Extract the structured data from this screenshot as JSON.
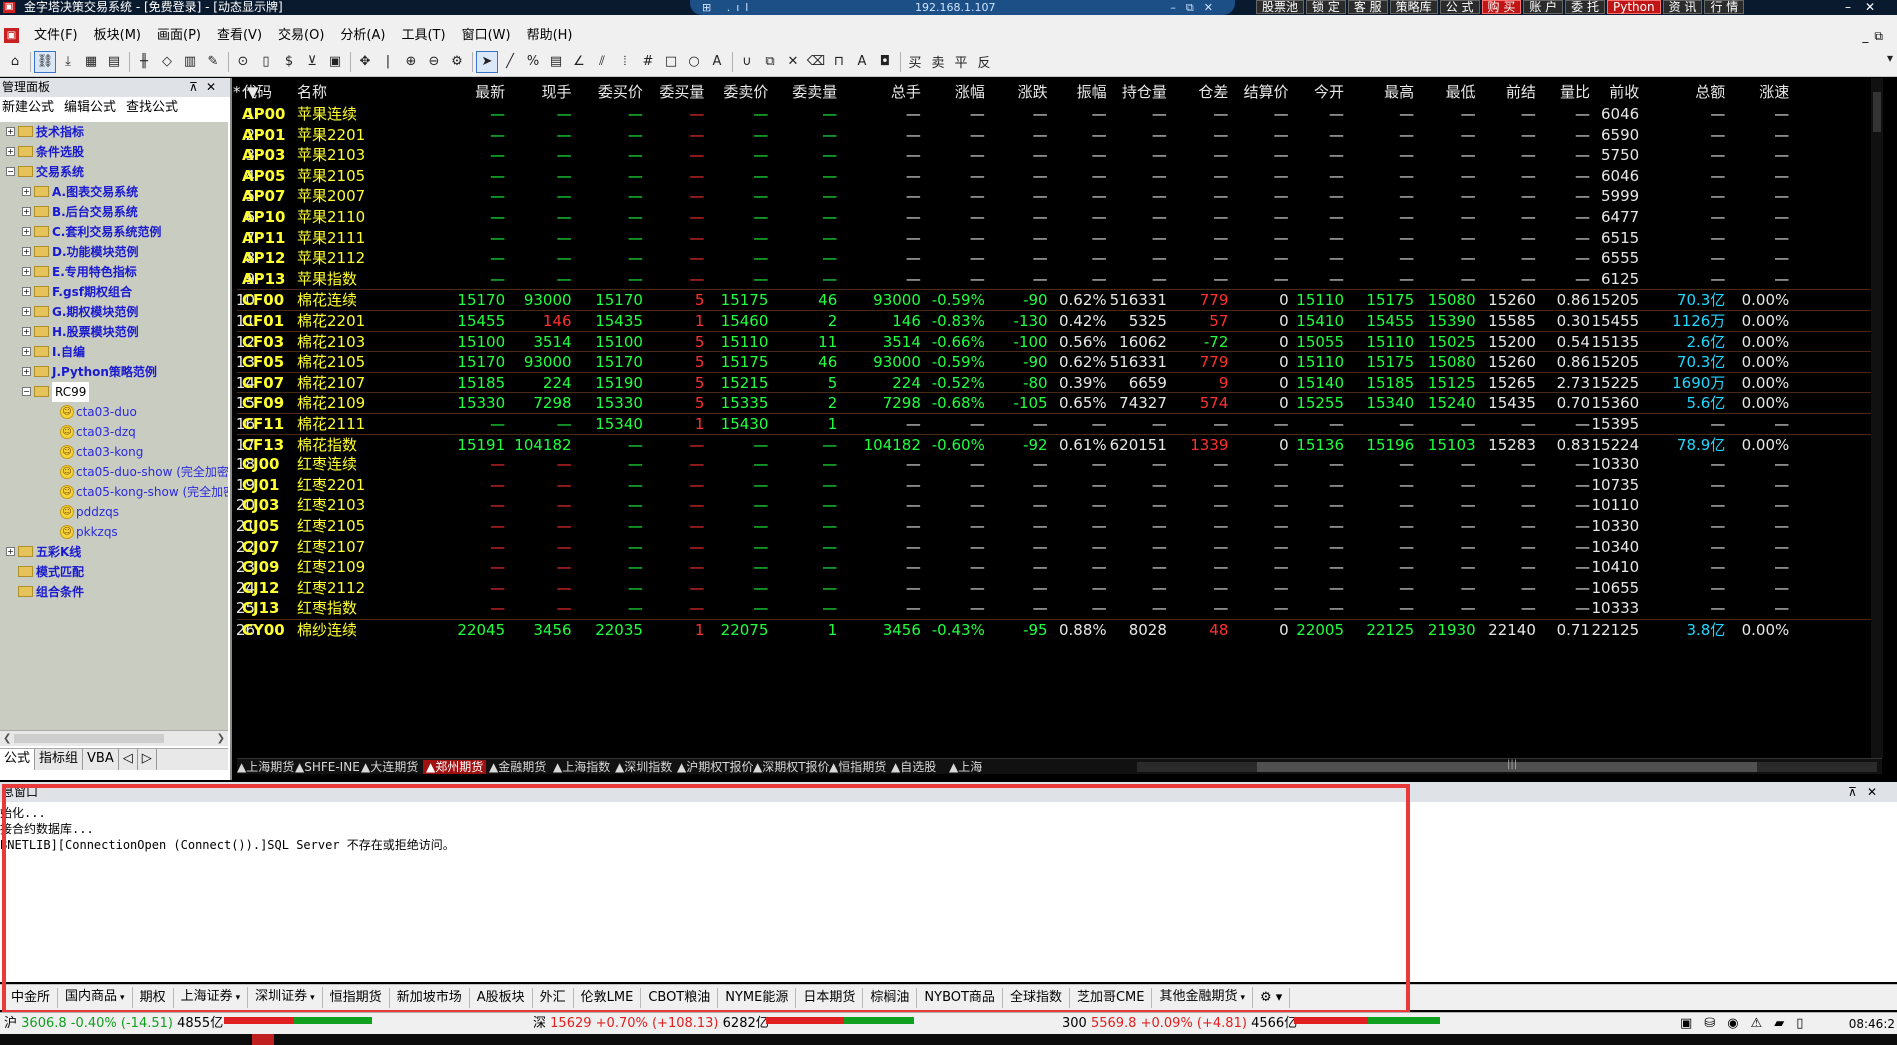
{
  "window": {
    "title": "金字塔决策交易系统 - [免费登录] - [动态显示牌]",
    "server_ip": "192.168.1.107"
  },
  "top_buttons": [
    "股票池",
    "锁 定",
    "客 服",
    "策略库",
    "公 式",
    "购 买",
    "账 户",
    "委 托",
    "Python",
    "资 讯",
    "行 情"
  ],
  "top_buttons_red": [
    "购 买",
    "Python"
  ],
  "menu": [
    "文件(F)",
    "板块(M)",
    "画面(P)",
    "查看(V)",
    "交易(O)",
    "分析(A)",
    "工具(T)",
    "窗口(W)",
    "帮助(H)"
  ],
  "left_panel": {
    "title": "管理面板",
    "actions": [
      "新建公式",
      "编辑公式",
      "查找公式"
    ],
    "tree": [
      {
        "label": "技术指标",
        "level": 0,
        "kind": "folder",
        "exp": "+"
      },
      {
        "label": "条件选股",
        "level": 0,
        "kind": "folder",
        "exp": "+"
      },
      {
        "label": "交易系统",
        "level": 0,
        "kind": "folder",
        "exp": "-"
      },
      {
        "label": "A.图表交易系统",
        "level": 1,
        "kind": "folder",
        "exp": "+"
      },
      {
        "label": "B.后台交易系统",
        "level": 1,
        "kind": "folder",
        "exp": "+"
      },
      {
        "label": "C.套利交易系统范例",
        "level": 1,
        "kind": "folder",
        "exp": "+"
      },
      {
        "label": "D.功能模块范例",
        "level": 1,
        "kind": "folder",
        "exp": "+"
      },
      {
        "label": "E.专用特色指标",
        "level": 1,
        "kind": "folder",
        "exp": "+"
      },
      {
        "label": "F.gsf期权组合",
        "level": 1,
        "kind": "folder",
        "exp": "+"
      },
      {
        "label": "G.期权模块范例",
        "level": 1,
        "kind": "folder",
        "exp": "+"
      },
      {
        "label": "H.股票模块范例",
        "level": 1,
        "kind": "folder",
        "exp": "+"
      },
      {
        "label": "I.自编",
        "level": 1,
        "kind": "folder",
        "exp": "+"
      },
      {
        "label": "J.Python策略范例",
        "level": 1,
        "kind": "folder",
        "exp": "+"
      },
      {
        "label": "RC99",
        "level": 1,
        "kind": "folder-sel",
        "exp": "-"
      },
      {
        "label": "cta03-duo",
        "level": 2,
        "kind": "leaf"
      },
      {
        "label": "cta03-dzq",
        "level": 2,
        "kind": "leaf"
      },
      {
        "label": "cta03-kong",
        "level": 2,
        "kind": "leaf"
      },
      {
        "label": "cta05-duo-show (完全加密",
        "level": 2,
        "kind": "leaf"
      },
      {
        "label": "cta05-kong-show (完全加密",
        "level": 2,
        "kind": "leaf"
      },
      {
        "label": "pddzqs",
        "level": 2,
        "kind": "leaf"
      },
      {
        "label": "pkkzqs",
        "level": 2,
        "kind": "leaf"
      },
      {
        "label": "五彩K线",
        "level": 0,
        "kind": "folder",
        "exp": "+"
      },
      {
        "label": "模式匹配",
        "level": 0,
        "kind": "folder",
        "exp": ""
      },
      {
        "label": "组合条件",
        "level": 0,
        "kind": "folder",
        "exp": ""
      }
    ],
    "tabs": [
      "公式",
      "指标组",
      "VBA",
      "◁",
      "▷"
    ]
  },
  "grid": {
    "headers": [
      "*",
      "代码",
      "名称",
      "最新",
      "现手",
      "委买价",
      "委买量",
      "委卖价",
      "委卖量",
      "总手",
      "涨幅",
      "涨跌",
      "振幅",
      "持仓量",
      "仓差",
      "结算价",
      "今开",
      "最高",
      "最低",
      "前结",
      "量比",
      "前收",
      "总额",
      "涨速"
    ],
    "rows": [
      [
        "1",
        "AP00",
        "苹果连续",
        "—",
        "—",
        "—",
        "—",
        "—",
        "—",
        "—",
        "—",
        "—",
        "—",
        "—",
        "—",
        "—",
        "—",
        "—",
        "—",
        "—",
        "—",
        "6046",
        "—",
        "—"
      ],
      [
        "2",
        "AP01",
        "苹果2201",
        "—",
        "—",
        "—",
        "—",
        "—",
        "—",
        "—",
        "—",
        "—",
        "—",
        "—",
        "—",
        "—",
        "—",
        "—",
        "—",
        "—",
        "—",
        "6590",
        "—",
        "—"
      ],
      [
        "3",
        "AP03",
        "苹果2103",
        "—",
        "—",
        "—",
        "—",
        "—",
        "—",
        "—",
        "—",
        "—",
        "—",
        "—",
        "—",
        "—",
        "—",
        "—",
        "—",
        "—",
        "—",
        "5750",
        "—",
        "—"
      ],
      [
        "4",
        "AP05",
        "苹果2105",
        "—",
        "—",
        "—",
        "—",
        "—",
        "—",
        "—",
        "—",
        "—",
        "—",
        "—",
        "—",
        "—",
        "—",
        "—",
        "—",
        "—",
        "—",
        "6046",
        "—",
        "—"
      ],
      [
        "5",
        "AP07",
        "苹果2007",
        "—",
        "—",
        "—",
        "—",
        "—",
        "—",
        "—",
        "—",
        "—",
        "—",
        "—",
        "—",
        "—",
        "—",
        "—",
        "—",
        "—",
        "—",
        "5999",
        "—",
        "—"
      ],
      [
        "6",
        "AP10",
        "苹果2110",
        "—",
        "—",
        "—",
        "—",
        "—",
        "—",
        "—",
        "—",
        "—",
        "—",
        "—",
        "—",
        "—",
        "—",
        "—",
        "—",
        "—",
        "—",
        "6477",
        "—",
        "—"
      ],
      [
        "7",
        "AP11",
        "苹果2111",
        "—",
        "—",
        "—",
        "—",
        "—",
        "—",
        "—",
        "—",
        "—",
        "—",
        "—",
        "—",
        "—",
        "—",
        "—",
        "—",
        "—",
        "—",
        "6515",
        "—",
        "—"
      ],
      [
        "8",
        "AP12",
        "苹果2112",
        "—",
        "—",
        "—",
        "—",
        "—",
        "—",
        "—",
        "—",
        "—",
        "—",
        "—",
        "—",
        "—",
        "—",
        "—",
        "—",
        "—",
        "—",
        "6555",
        "—",
        "—"
      ],
      [
        "9",
        "AP13",
        "苹果指数",
        "—",
        "—",
        "—",
        "—",
        "—",
        "—",
        "—",
        "—",
        "—",
        "—",
        "—",
        "—",
        "—",
        "—",
        "—",
        "—",
        "—",
        "—",
        "6125",
        "—",
        "—"
      ],
      [
        "10",
        "CF00",
        "棉花连续",
        "15170",
        "93000",
        "15170",
        "5",
        "15175",
        "46",
        "93000",
        "-0.59%",
        "-90",
        "0.62%",
        "516331",
        "779",
        "0",
        "15110",
        "15175",
        "15080",
        "15260",
        "0.86",
        "15205",
        "70.3亿",
        "0.00%"
      ],
      [
        "11",
        "CF01",
        "棉花2201",
        "15455",
        "146",
        "15435",
        "1",
        "15460",
        "2",
        "146",
        "-0.83%",
        "-130",
        "0.42%",
        "5325",
        "57",
        "0",
        "15410",
        "15455",
        "15390",
        "15585",
        "0.30",
        "15455",
        "1126万",
        "0.00%"
      ],
      [
        "12",
        "CF03",
        "棉花2103",
        "15100",
        "3514",
        "15100",
        "5",
        "15110",
        "11",
        "3514",
        "-0.66%",
        "-100",
        "0.56%",
        "16062",
        "-72",
        "0",
        "15055",
        "15110",
        "15025",
        "15200",
        "0.54",
        "15135",
        "2.6亿",
        "0.00%"
      ],
      [
        "13",
        "CF05",
        "棉花2105",
        "15170",
        "93000",
        "15170",
        "5",
        "15175",
        "46",
        "93000",
        "-0.59%",
        "-90",
        "0.62%",
        "516331",
        "779",
        "0",
        "15110",
        "15175",
        "15080",
        "15260",
        "0.86",
        "15205",
        "70.3亿",
        "0.00%"
      ],
      [
        "14",
        "CF07",
        "棉花2107",
        "15185",
        "224",
        "15190",
        "5",
        "15215",
        "5",
        "224",
        "-0.52%",
        "-80",
        "0.39%",
        "6659",
        "9",
        "0",
        "15140",
        "15185",
        "15125",
        "15265",
        "2.73",
        "15225",
        "1690万",
        "0.00%"
      ],
      [
        "15",
        "CF09",
        "棉花2109",
        "15330",
        "7298",
        "15330",
        "5",
        "15335",
        "2",
        "7298",
        "-0.68%",
        "-105",
        "0.65%",
        "74327",
        "574",
        "0",
        "15255",
        "15340",
        "15240",
        "15435",
        "0.70",
        "15360",
        "5.6亿",
        "0.00%"
      ],
      [
        "16",
        "CF11",
        "棉花2111",
        "—",
        "—",
        "15340",
        "1",
        "15430",
        "1",
        "—",
        "—",
        "—",
        "—",
        "—",
        "—",
        "—",
        "—",
        "—",
        "—",
        "—",
        "—",
        "15395",
        "—",
        "—"
      ],
      [
        "17",
        "CF13",
        "棉花指数",
        "15191",
        "104182",
        "—",
        "—",
        "—",
        "—",
        "104182",
        "-0.60%",
        "-92",
        "0.61%",
        "620151",
        "1339",
        "0",
        "15136",
        "15196",
        "15103",
        "15283",
        "0.83",
        "15224",
        "78.9亿",
        "0.00%"
      ],
      [
        "18",
        "CJ00",
        "红枣连续",
        "—",
        "—",
        "—",
        "—",
        "—",
        "—",
        "—",
        "—",
        "—",
        "—",
        "—",
        "—",
        "—",
        "—",
        "—",
        "—",
        "—",
        "—",
        "10330",
        "—",
        "—"
      ],
      [
        "19",
        "CJ01",
        "红枣2201",
        "—",
        "—",
        "—",
        "—",
        "—",
        "—",
        "—",
        "—",
        "—",
        "—",
        "—",
        "—",
        "—",
        "—",
        "—",
        "—",
        "—",
        "—",
        "10735",
        "—",
        "—"
      ],
      [
        "20",
        "CJ03",
        "红枣2103",
        "—",
        "—",
        "—",
        "—",
        "—",
        "—",
        "—",
        "—",
        "—",
        "—",
        "—",
        "—",
        "—",
        "—",
        "—",
        "—",
        "—",
        "—",
        "10110",
        "—",
        "—"
      ],
      [
        "21",
        "CJ05",
        "红枣2105",
        "—",
        "—",
        "—",
        "—",
        "—",
        "—",
        "—",
        "—",
        "—",
        "—",
        "—",
        "—",
        "—",
        "—",
        "—",
        "—",
        "—",
        "—",
        "10330",
        "—",
        "—"
      ],
      [
        "22",
        "CJ07",
        "红枣2107",
        "—",
        "—",
        "—",
        "—",
        "—",
        "—",
        "—",
        "—",
        "—",
        "—",
        "—",
        "—",
        "—",
        "—",
        "—",
        "—",
        "—",
        "—",
        "10340",
        "—",
        "—"
      ],
      [
        "23",
        "CJ09",
        "红枣2109",
        "—",
        "—",
        "—",
        "—",
        "—",
        "—",
        "—",
        "—",
        "—",
        "—",
        "—",
        "—",
        "—",
        "—",
        "—",
        "—",
        "—",
        "—",
        "10410",
        "—",
        "—"
      ],
      [
        "24",
        "CJ12",
        "红枣2112",
        "—",
        "—",
        "—",
        "—",
        "—",
        "—",
        "—",
        "—",
        "—",
        "—",
        "—",
        "—",
        "—",
        "—",
        "—",
        "—",
        "—",
        "—",
        "10655",
        "—",
        "—"
      ],
      [
        "25",
        "CJ13",
        "红枣指数",
        "—",
        "—",
        "—",
        "—",
        "—",
        "—",
        "—",
        "—",
        "—",
        "—",
        "—",
        "—",
        "—",
        "—",
        "—",
        "—",
        "—",
        "—",
        "10333",
        "—",
        "—"
      ],
      [
        "26",
        "CY00",
        "棉纱连续",
        "22045",
        "3456",
        "22035",
        "1",
        "22075",
        "1",
        "3456",
        "-0.43%",
        "-95",
        "0.88%",
        "8028",
        "48",
        "0",
        "22005",
        "22125",
        "21930",
        "22140",
        "0.71",
        "22125",
        "3.8亿",
        "0.00%"
      ]
    ]
  },
  "sheet_tabs": [
    "▲上海期货",
    "▲SHFE-INE",
    "▲大连期货",
    "▲郑州期货",
    "▲金融期货",
    "▲上海指数",
    "▲深圳指数",
    "▲沪期权T报价",
    "▲深期权T报价",
    "▲恒指期货",
    "▲自选股",
    "▲上海"
  ],
  "sheet_tab_active": "▲郑州期货",
  "message_window": {
    "title": "息窗口",
    "lines": [
      "始化...",
      "接合约数据库...",
      "BNETLIB][ConnectionOpen (Connect()).]SQL Server 不存在或拒绝访问。"
    ]
  },
  "market_tabs": [
    {
      "label": "中金所",
      "dd": false
    },
    {
      "label": "国内商品",
      "dd": true
    },
    {
      "label": "期权",
      "dd": false
    },
    {
      "label": "上海证券",
      "dd": true
    },
    {
      "label": "深圳证券",
      "dd": true
    },
    {
      "label": "恒指期货",
      "dd": false
    },
    {
      "label": "新加坡市场",
      "dd": false
    },
    {
      "label": "A股板块",
      "dd": false
    },
    {
      "label": "外汇",
      "dd": false
    },
    {
      "label": "伦敦LME",
      "dd": false
    },
    {
      "label": "CBOT粮油",
      "dd": false
    },
    {
      "label": "NYME能源",
      "dd": false
    },
    {
      "label": "日本期货",
      "dd": false
    },
    {
      "label": "棕榈油",
      "dd": false
    },
    {
      "label": "NYBOT商品",
      "dd": false
    },
    {
      "label": "全球指数",
      "dd": false
    },
    {
      "label": "芝加哥CME",
      "dd": false
    },
    {
      "label": "其他金融期货",
      "dd": true
    }
  ],
  "status": {
    "sh": {
      "name": "沪",
      "value": "3606.8",
      "change": "-0.40% (-14.51)",
      "amount": "4855亿"
    },
    "sz": {
      "name": "深",
      "value": "15629",
      "change": "+0.70% (+108.13)",
      "amount": "6282亿"
    },
    "i300": {
      "name": "300",
      "value": "5569.8",
      "change": "+0.09% (+4.81)",
      "amount": "4566亿"
    },
    "time": "08:46:2"
  },
  "colors": {
    "up": "#20ff40",
    "down": "#ff3030",
    "code": "#ffff30",
    "highlight_box": "#e83a3a"
  }
}
